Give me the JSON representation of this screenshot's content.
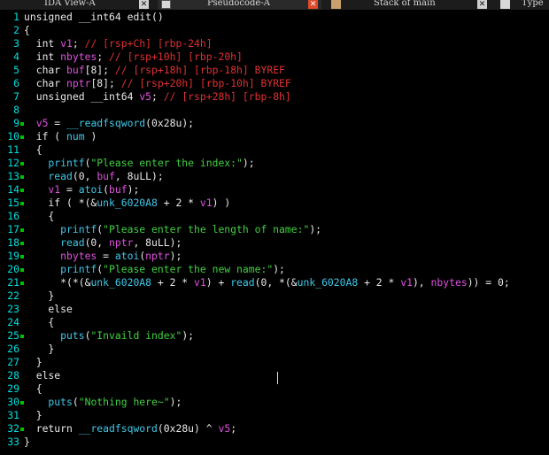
{
  "tabs": [
    {
      "label": "IDA View-A",
      "icon": "grid-icon",
      "close": "✕"
    },
    {
      "label": "Pseudocode-A",
      "icon": "document-icon",
      "close": "✕"
    },
    {
      "label": "Stack of main",
      "icon": "stack-icon",
      "close": "✕"
    },
    {
      "label": "Type",
      "icon": "type-icon",
      "close": ""
    }
  ],
  "lines": [
    {
      "n": "1",
      "dot": false,
      "segs": [
        [
          "kw",
          "unsigned __int64 edit()"
        ]
      ]
    },
    {
      "n": "2",
      "dot": false,
      "segs": [
        [
          "kw",
          "{"
        ]
      ]
    },
    {
      "n": "3",
      "dot": false,
      "segs": [
        [
          "kw",
          "  int "
        ],
        [
          "var",
          "v1"
        ],
        [
          "kw",
          "; "
        ],
        [
          "cmt",
          "// [rsp+Ch] [rbp-24h]"
        ]
      ]
    },
    {
      "n": "4",
      "dot": false,
      "segs": [
        [
          "kw",
          "  int "
        ],
        [
          "var",
          "nbytes"
        ],
        [
          "kw",
          "; "
        ],
        [
          "cmt",
          "// [rsp+10h] [rbp-20h]"
        ]
      ]
    },
    {
      "n": "5",
      "dot": false,
      "segs": [
        [
          "kw",
          "  char "
        ],
        [
          "var",
          "buf"
        ],
        [
          "kw",
          "[8]; "
        ],
        [
          "cmt",
          "// [rsp+18h] [rbp-18h] BYREF"
        ]
      ]
    },
    {
      "n": "6",
      "dot": false,
      "segs": [
        [
          "kw",
          "  char "
        ],
        [
          "var",
          "nptr"
        ],
        [
          "kw",
          "[8]; "
        ],
        [
          "cmt",
          "// [rsp+20h] [rbp-10h] BYREF"
        ]
      ]
    },
    {
      "n": "7",
      "dot": false,
      "segs": [
        [
          "kw",
          "  unsigned __int64 "
        ],
        [
          "var",
          "v5"
        ],
        [
          "kw",
          "; "
        ],
        [
          "cmt",
          "// [rsp+28h] [rbp-8h]"
        ]
      ]
    },
    {
      "n": "8",
      "dot": false,
      "segs": [
        [
          "kw",
          ""
        ]
      ]
    },
    {
      "n": "9",
      "dot": true,
      "segs": [
        [
          "var",
          "  v5"
        ],
        [
          "kw",
          " = "
        ],
        [
          "fn",
          "__readfsqword"
        ],
        [
          "kw",
          "(0x28u);"
        ]
      ]
    },
    {
      "n": "10",
      "dot": true,
      "segs": [
        [
          "kw",
          "  if ( "
        ],
        [
          "glob",
          "num"
        ],
        [
          "kw",
          " )"
        ]
      ]
    },
    {
      "n": "11",
      "dot": false,
      "segs": [
        [
          "kw",
          "  {"
        ]
      ]
    },
    {
      "n": "12",
      "dot": true,
      "segs": [
        [
          "fn",
          "    printf"
        ],
        [
          "kw",
          "("
        ],
        [
          "str",
          "\"Please enter the index:\""
        ],
        [
          "kw",
          ");"
        ]
      ]
    },
    {
      "n": "13",
      "dot": true,
      "segs": [
        [
          "fn",
          "    read"
        ],
        [
          "kw",
          "(0, "
        ],
        [
          "var",
          "buf"
        ],
        [
          "kw",
          ", 8uLL);"
        ]
      ]
    },
    {
      "n": "14",
      "dot": true,
      "segs": [
        [
          "var",
          "    v1"
        ],
        [
          "kw",
          " = "
        ],
        [
          "fn",
          "atoi"
        ],
        [
          "kw",
          "("
        ],
        [
          "var",
          "buf"
        ],
        [
          "kw",
          ");"
        ]
      ]
    },
    {
      "n": "15",
      "dot": true,
      "segs": [
        [
          "kw",
          "    if ( *(&"
        ],
        [
          "glob",
          "unk_6020A8"
        ],
        [
          "kw",
          " + 2 * "
        ],
        [
          "var",
          "v1"
        ],
        [
          "kw",
          ") )"
        ]
      ]
    },
    {
      "n": "16",
      "dot": false,
      "segs": [
        [
          "kw",
          "    {"
        ]
      ]
    },
    {
      "n": "17",
      "dot": true,
      "segs": [
        [
          "fn",
          "      printf"
        ],
        [
          "kw",
          "("
        ],
        [
          "str",
          "\"Please enter the length of name:\""
        ],
        [
          "kw",
          ");"
        ]
      ]
    },
    {
      "n": "18",
      "dot": true,
      "segs": [
        [
          "fn",
          "      read"
        ],
        [
          "kw",
          "(0, "
        ],
        [
          "var",
          "nptr"
        ],
        [
          "kw",
          ", 8uLL);"
        ]
      ]
    },
    {
      "n": "19",
      "dot": true,
      "segs": [
        [
          "var",
          "      nbytes"
        ],
        [
          "kw",
          " = "
        ],
        [
          "fn",
          "atoi"
        ],
        [
          "kw",
          "("
        ],
        [
          "var",
          "nptr"
        ],
        [
          "kw",
          ");"
        ]
      ]
    },
    {
      "n": "20",
      "dot": true,
      "segs": [
        [
          "fn",
          "      printf"
        ],
        [
          "kw",
          "("
        ],
        [
          "str",
          "\"Please enter the new name:\""
        ],
        [
          "kw",
          ");"
        ]
      ]
    },
    {
      "n": "21",
      "dot": true,
      "segs": [
        [
          "kw",
          "      *(*(&"
        ],
        [
          "glob",
          "unk_6020A8"
        ],
        [
          "kw",
          " + 2 * "
        ],
        [
          "var",
          "v1"
        ],
        [
          "kw",
          ") + "
        ],
        [
          "fn",
          "read"
        ],
        [
          "kw",
          "(0, *(&"
        ],
        [
          "glob",
          "unk_6020A8"
        ],
        [
          "kw",
          " + 2 * "
        ],
        [
          "var",
          "v1"
        ],
        [
          "kw",
          "), "
        ],
        [
          "var",
          "nbytes"
        ],
        [
          "kw",
          ")) = 0;"
        ]
      ]
    },
    {
      "n": "22",
      "dot": false,
      "segs": [
        [
          "kw",
          "    }"
        ]
      ]
    },
    {
      "n": "23",
      "dot": false,
      "segs": [
        [
          "kw",
          "    else"
        ]
      ]
    },
    {
      "n": "24",
      "dot": false,
      "segs": [
        [
          "kw",
          "    {"
        ]
      ]
    },
    {
      "n": "25",
      "dot": true,
      "segs": [
        [
          "fn",
          "      puts"
        ],
        [
          "kw",
          "("
        ],
        [
          "str",
          "\"Invaild index\""
        ],
        [
          "kw",
          ");"
        ]
      ]
    },
    {
      "n": "26",
      "dot": false,
      "segs": [
        [
          "kw",
          "    }"
        ]
      ]
    },
    {
      "n": "27",
      "dot": false,
      "segs": [
        [
          "kw",
          "  }"
        ]
      ]
    },
    {
      "n": "28",
      "dot": false,
      "segs": [
        [
          "kw",
          "  else"
        ]
      ]
    },
    {
      "n": "29",
      "dot": false,
      "segs": [
        [
          "kw",
          "  {"
        ]
      ]
    },
    {
      "n": "30",
      "dot": true,
      "segs": [
        [
          "fn",
          "    puts"
        ],
        [
          "kw",
          "("
        ],
        [
          "str",
          "\"Nothing here~\""
        ],
        [
          "kw",
          ");"
        ]
      ]
    },
    {
      "n": "31",
      "dot": false,
      "segs": [
        [
          "kw",
          "  }"
        ]
      ]
    },
    {
      "n": "32",
      "dot": true,
      "segs": [
        [
          "kw",
          "  return "
        ],
        [
          "fn",
          "__readfsqword"
        ],
        [
          "kw",
          "(0x28u) ^ "
        ],
        [
          "var",
          "v5"
        ],
        [
          "kw",
          ";"
        ]
      ]
    },
    {
      "n": "33",
      "dot": false,
      "segs": [
        [
          "kw",
          "}"
        ]
      ]
    }
  ]
}
